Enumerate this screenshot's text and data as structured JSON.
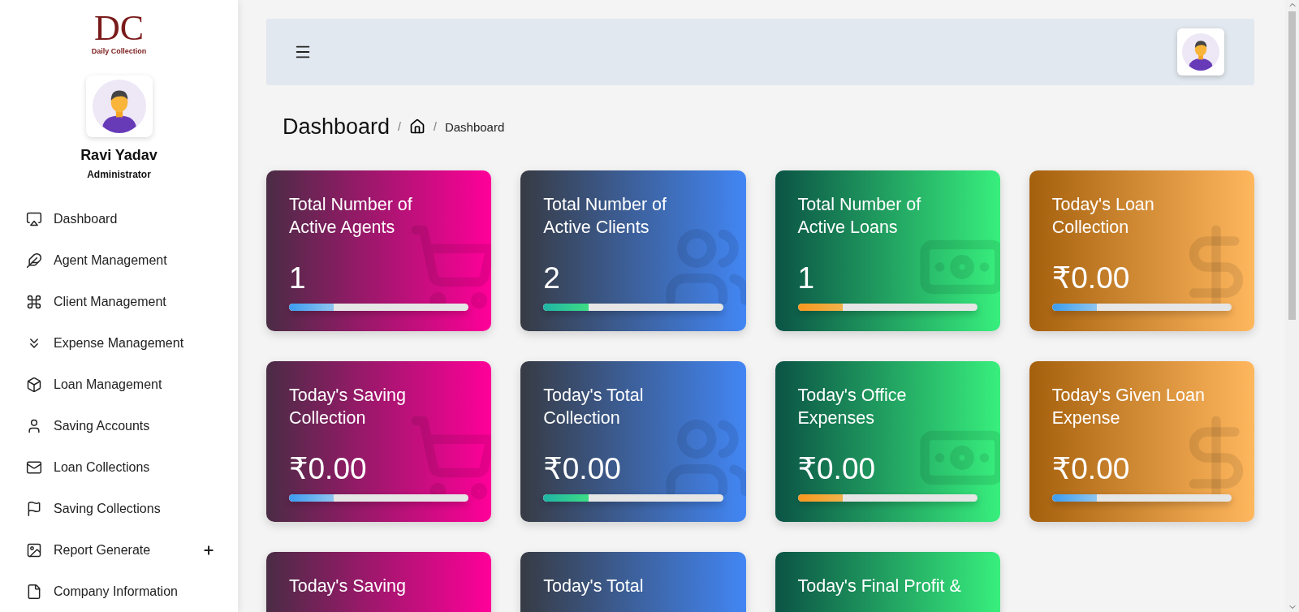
{
  "logo": {
    "initials": "DC",
    "tagline": "Daily Collection"
  },
  "user": {
    "name": "Ravi Yadav",
    "role": "Administrator"
  },
  "sidebar": {
    "items": [
      {
        "label": "Dashboard",
        "kind": "airplay",
        "expandable": false
      },
      {
        "label": "Agent Management",
        "kind": "feather",
        "expandable": false
      },
      {
        "label": "Client Management",
        "kind": "command",
        "expandable": false
      },
      {
        "label": "Expense Management",
        "kind": "chevrons",
        "expandable": false
      },
      {
        "label": "Loan Management",
        "kind": "box",
        "expandable": false
      },
      {
        "label": "Saving Accounts",
        "kind": "user",
        "expandable": false
      },
      {
        "label": "Loan Collections",
        "kind": "mail",
        "expandable": false
      },
      {
        "label": "Saving Collections",
        "kind": "flag",
        "expandable": false
      },
      {
        "label": "Report Generate",
        "kind": "image",
        "expandable": true
      },
      {
        "label": "Company Information",
        "kind": "file",
        "expandable": false
      }
    ]
  },
  "breadcrumb": {
    "title": "Dashboard",
    "separator": "/",
    "items": [
      {
        "kind": "home"
      },
      {
        "kind": "text",
        "label": "Dashboard"
      }
    ]
  },
  "cards": [
    {
      "kind": "cart",
      "title_lines": [
        "Total Number of",
        "Active Agents"
      ],
      "value": "1",
      "level": 0.25
    },
    {
      "kind": "users",
      "title_lines": [
        "Total Number of",
        "Active Clients"
      ],
      "value": "2",
      "level": 0.25
    },
    {
      "kind": "money",
      "title_lines": [
        "Total Number of",
        "Active Loans"
      ],
      "value": "1",
      "level": 0.25
    },
    {
      "kind": "dollar",
      "title_lines": [
        "Today's Loan",
        "Collection"
      ],
      "value": "₹0.00",
      "level": 0.25
    },
    {
      "kind": "cart",
      "title_lines": [
        "Today's Saving",
        "Collection"
      ],
      "value": "₹0.00",
      "level": 0.25
    },
    {
      "kind": "users",
      "title_lines": [
        "Today's Total",
        "Collection"
      ],
      "value": "₹0.00",
      "level": 0.25
    },
    {
      "kind": "money",
      "title_lines": [
        "Today's Office",
        "Expenses"
      ],
      "value": "₹0.00",
      "level": 0.25
    },
    {
      "kind": "dollar",
      "title_lines": [
        "Today's Given Loan",
        "Expense"
      ],
      "value": "₹0.00",
      "level": 0.25
    },
    {
      "kind": "cart",
      "title_lines": [
        "Today's Saving"
      ]
    },
    {
      "kind": "users",
      "title_lines": [
        "Today's Total"
      ]
    },
    {
      "kind": "money",
      "title_lines": [
        "Today's Final Profit &"
      ]
    }
  ]
}
